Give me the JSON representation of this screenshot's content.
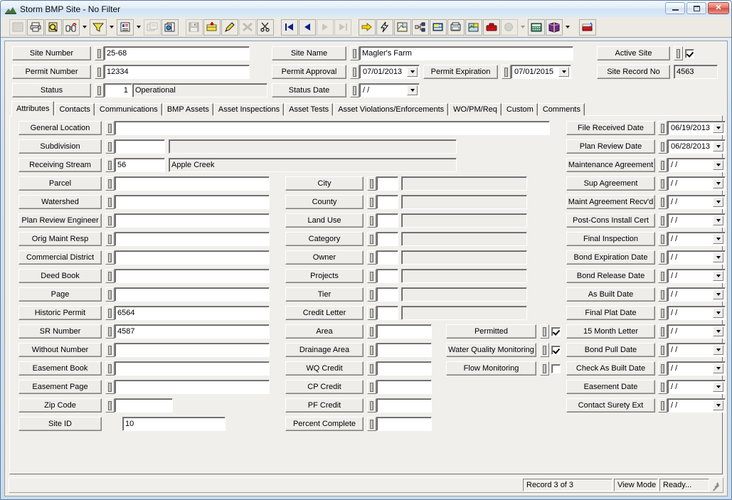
{
  "window": {
    "title": "Storm BMP Site - No Filter",
    "icon": "site-hill-icon",
    "buttons": {
      "minimize": "minimize",
      "maximize": "maximize",
      "close": "close"
    }
  },
  "toolbar": {
    "items": [
      {
        "name": "select-all-icon",
        "glyph": "grid",
        "framed": true,
        "dim": true
      },
      {
        "name": "print-icon",
        "glyph": "printer",
        "framed": true
      },
      {
        "name": "print-preview-icon",
        "glyph": "preview",
        "framed": true
      },
      {
        "name": "find-icon",
        "glyph": "binoculars",
        "framed": true
      },
      {
        "name": "find-dropdown-arrow",
        "glyph": "arrow"
      },
      {
        "name": "filter-icon",
        "glyph": "funnel",
        "framed": true
      },
      {
        "name": "filter-dropdown-arrow",
        "glyph": "arrow"
      },
      {
        "name": "report-icon",
        "glyph": "report",
        "framed": true
      },
      {
        "name": "report-dropdown-arrow",
        "glyph": "arrow"
      },
      {
        "name": "properties-icon",
        "glyph": "props",
        "framed": true,
        "dim": true
      },
      {
        "name": "copy-record-icon",
        "glyph": "copyrec",
        "framed": true
      },
      {
        "name": "separator-1",
        "glyph": "sep"
      },
      {
        "name": "save-icon",
        "glyph": "save",
        "framed": true,
        "dim": true
      },
      {
        "name": "add-record-icon",
        "glyph": "addrec",
        "framed": true
      },
      {
        "name": "edit-record-icon",
        "glyph": "pencil",
        "framed": true
      },
      {
        "name": "delete-record-icon",
        "glyph": "xmark",
        "framed": true,
        "dim": true
      },
      {
        "name": "cut-icon",
        "glyph": "scissors",
        "framed": true
      },
      {
        "name": "separator-2",
        "glyph": "sep"
      },
      {
        "name": "first-record-icon",
        "glyph": "first",
        "framed": true
      },
      {
        "name": "previous-record-icon",
        "glyph": "prev",
        "framed": true
      },
      {
        "name": "next-record-icon",
        "glyph": "next",
        "framed": true,
        "dim": true
      },
      {
        "name": "last-record-icon",
        "glyph": "last",
        "framed": true,
        "dim": true
      },
      {
        "name": "separator-3",
        "glyph": "sep"
      },
      {
        "name": "goto-icon",
        "glyph": "yellowarrow",
        "framed": true
      },
      {
        "name": "quick-action-icon",
        "glyph": "lightning",
        "framed": true
      },
      {
        "name": "map-icon",
        "glyph": "mapsheet",
        "framed": true
      },
      {
        "name": "hierarchy-icon",
        "glyph": "tree",
        "framed": true
      },
      {
        "name": "workorder-icon",
        "glyph": "wo",
        "framed": true
      },
      {
        "name": "fax-icon",
        "glyph": "fax",
        "framed": true
      },
      {
        "name": "gis-icon",
        "glyph": "gis",
        "framed": true
      },
      {
        "name": "toolbox-icon",
        "glyph": "toolbox",
        "framed": true
      },
      {
        "name": "help-balloon-icon",
        "glyph": "balloon",
        "framed": true,
        "dim": true
      },
      {
        "name": "help-dropdown-arrow",
        "glyph": "arrow",
        "dim": true
      },
      {
        "name": "calculator-icon",
        "glyph": "calc",
        "framed": true
      },
      {
        "name": "books-icon",
        "glyph": "book",
        "framed": true
      },
      {
        "name": "books-dropdown-arrow",
        "glyph": "arrow"
      },
      {
        "name": "separator-4",
        "glyph": "sep"
      },
      {
        "name": "exit-icon",
        "glyph": "exit",
        "framed": true
      }
    ]
  },
  "header": {
    "left": [
      {
        "label": "Site Number",
        "value": "25-68"
      },
      {
        "label": "Permit Number",
        "value": "12334"
      },
      {
        "label": "Status",
        "code": "1",
        "value": "Operational"
      }
    ],
    "mid": [
      {
        "label": "Site Name",
        "value": "Magler's Farm"
      },
      {
        "label": "Permit Approval",
        "value": "07/01/2013"
      },
      {
        "label": "Status Date",
        "value": "/  /"
      }
    ],
    "permit_expiration": {
      "label": "Permit Expiration",
      "value": "07/01/2015"
    },
    "right": [
      {
        "label": "Active Site",
        "checked": true
      },
      {
        "label": "Site Record No",
        "value": "4563"
      }
    ]
  },
  "tabs": [
    {
      "label": "Attributes",
      "active": true
    },
    {
      "label": "Contacts",
      "active": false
    },
    {
      "label": "Communications",
      "active": false
    },
    {
      "label": "BMP Assets",
      "active": false
    },
    {
      "label": "Asset Inspections",
      "active": false
    },
    {
      "label": "Asset Tests",
      "active": false
    },
    {
      "label": "Asset Violations/Enforcements",
      "active": false
    },
    {
      "label": "WO/PM/Req",
      "active": false
    },
    {
      "label": "Custom",
      "active": false
    },
    {
      "label": "Comments",
      "active": false
    }
  ],
  "attributes": {
    "wide_rows": [
      {
        "label": "General Location",
        "value": "",
        "style": "full"
      },
      {
        "label": "Subdivision",
        "code": "",
        "desc": "",
        "style": "code-desc"
      },
      {
        "label": "Receiving Stream",
        "code": "56",
        "desc": "Apple Creek",
        "style": "code-desc"
      }
    ],
    "left_column": [
      {
        "label": "Parcel",
        "value": ""
      },
      {
        "label": "Watershed",
        "value": ""
      },
      {
        "label": "Plan Review Engineer",
        "value": ""
      },
      {
        "label": "Orig Maint Resp",
        "value": ""
      },
      {
        "label": "Commercial District",
        "value": ""
      },
      {
        "label": "Deed Book",
        "value": ""
      },
      {
        "label": "Page",
        "value": ""
      },
      {
        "label": "Historic Permit",
        "value": "6564"
      },
      {
        "label": "SR Number",
        "value": "4587"
      },
      {
        "label": "Without Number",
        "value": ""
      },
      {
        "label": "Easement Book",
        "value": ""
      },
      {
        "label": "Easement Page",
        "value": ""
      },
      {
        "label": "Zip Code",
        "value": "",
        "short": true
      },
      {
        "label": "Site ID",
        "value": "10",
        "nospin": true
      }
    ],
    "mid_column": [
      {
        "label": "City",
        "code": "",
        "desc": ""
      },
      {
        "label": "County",
        "code": "",
        "desc": ""
      },
      {
        "label": "Land Use",
        "code": "",
        "desc": ""
      },
      {
        "label": "Category",
        "code": "",
        "desc": ""
      },
      {
        "label": "Owner",
        "code": "",
        "desc": ""
      },
      {
        "label": "Projects",
        "code": "",
        "desc": ""
      },
      {
        "label": "Tier",
        "code": "",
        "desc": ""
      },
      {
        "label": "Credit Letter",
        "code": "",
        "desc": ""
      },
      {
        "label": "Area",
        "value": "",
        "single": true
      },
      {
        "label": "Drainage Area",
        "value": "",
        "single": true
      },
      {
        "label": "WQ Credit",
        "value": "",
        "single": true
      },
      {
        "label": "CP Credit",
        "value": "",
        "single": true
      },
      {
        "label": "PF Credit",
        "value": "",
        "single": true
      },
      {
        "label": "Percent Complete",
        "value": "",
        "single": true
      }
    ],
    "checkboxes": [
      {
        "label": "Permitted",
        "checked": true
      },
      {
        "label": "Water Quality Monitoring",
        "checked": true
      },
      {
        "label": "Flow Monitoring",
        "checked": false
      }
    ],
    "date_column": [
      {
        "label": "File Received Date",
        "value": "06/19/2013"
      },
      {
        "label": "Plan Review Date",
        "value": "06/28/2013"
      },
      {
        "label": "Maintenance Agreement",
        "value": "/  /"
      },
      {
        "label": "Sup Agreement",
        "value": "/  /"
      },
      {
        "label": "Maint Agreement Recv'd",
        "value": "/  /"
      },
      {
        "label": "Post-Cons Install Cert",
        "value": "/  /"
      },
      {
        "label": "Final Inspection",
        "value": "/  /"
      },
      {
        "label": "Bond Expiration Date",
        "value": "/  /"
      },
      {
        "label": "Bond Release Date",
        "value": "/  /"
      },
      {
        "label": "As Built Date",
        "value": "/  /"
      },
      {
        "label": "Final Plat Date",
        "value": "/  /"
      },
      {
        "label": "15 Month Letter",
        "value": "/  /"
      },
      {
        "label": "Bond Pull Date",
        "value": "/  /"
      },
      {
        "label": "Check As Built Date",
        "value": "/  /"
      },
      {
        "label": "Easement Date",
        "value": "/  /"
      },
      {
        "label": "Contact Surety Ext",
        "value": "/  /"
      }
    ]
  },
  "statusbar": {
    "record": "Record 3 of 3",
    "mode": "View Mode",
    "state": "Ready..."
  },
  "colors": {
    "window_frame": "#5a7ca6",
    "face": "#f0efeb",
    "control_face": "#eeedea",
    "readonly_field": "#eeedea",
    "text": "#000000"
  }
}
